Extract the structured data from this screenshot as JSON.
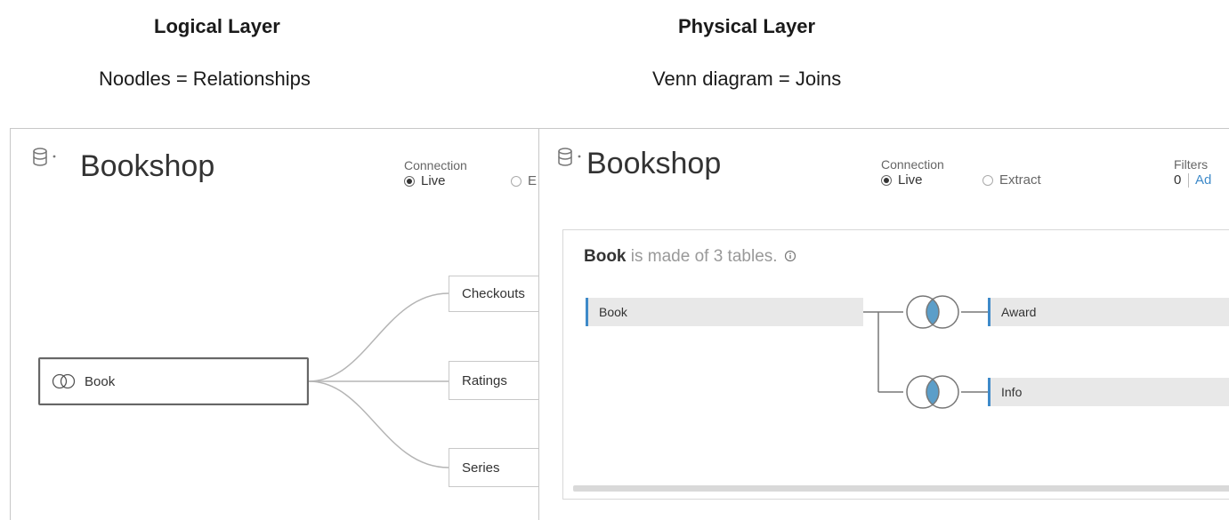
{
  "headings": {
    "logical_title": "Logical Layer",
    "logical_subtitle": "Noodles = Relationships",
    "physical_title": "Physical Layer",
    "physical_subtitle": "Venn diagram = Joins"
  },
  "logical_panel": {
    "datasource_name": "Bookshop",
    "connection_label": "Connection",
    "connection_options": [
      "Live",
      "E"
    ],
    "connection_selected": "Live",
    "root_table": "Book",
    "related_tables": [
      "Checkouts",
      "Ratings",
      "Series"
    ]
  },
  "physical_panel": {
    "datasource_name": "Bookshop",
    "connection_label": "Connection",
    "connection_options": [
      "Live",
      "Extract"
    ],
    "connection_selected": "Live",
    "filters_label": "Filters",
    "filters_count": "0",
    "filters_add": "Ad",
    "made_of_table": "Book",
    "made_of_text": "is made of 3 tables.",
    "left_table": "Book",
    "joined_tables": [
      "Award",
      "Info"
    ]
  },
  "colors": {
    "accent": "#3e8ac9",
    "venn_fill": "#5b9ec9"
  },
  "icons": {
    "datasource": "cylinder-icon",
    "dropdown": "caret-down-icon",
    "info": "info-circle-icon",
    "join": "venn-inner-join-icon",
    "relationship": "overlapping-circles-icon"
  }
}
